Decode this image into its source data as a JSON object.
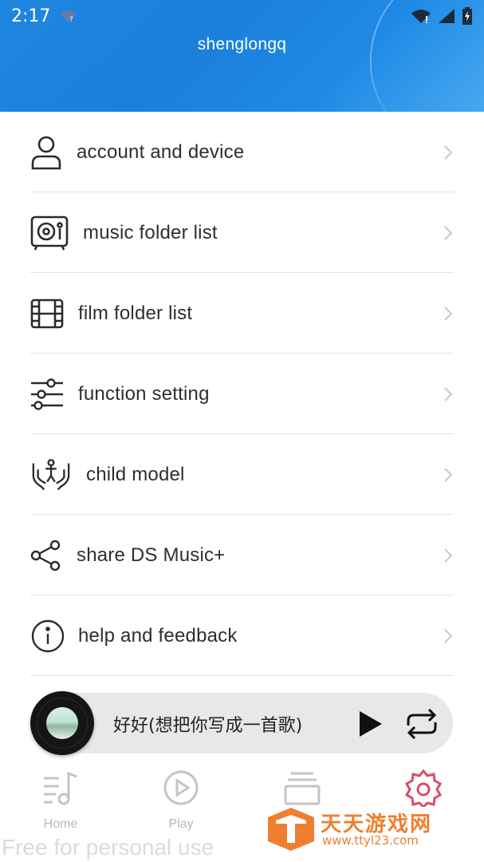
{
  "status_bar": {
    "time": "2:17",
    "icons": [
      "wifi-question-icon",
      "wifi-icon",
      "signal-icon",
      "battery-charging-icon"
    ]
  },
  "header": {
    "username": "shenglongq",
    "bg_color": "#1f86e0"
  },
  "menu": {
    "items": [
      {
        "label": "account and device",
        "icon": "person-icon"
      },
      {
        "label": "music folder list",
        "icon": "music-box-icon"
      },
      {
        "label": "film folder list",
        "icon": "film-icon"
      },
      {
        "label": "function setting",
        "icon": "sliders-icon"
      },
      {
        "label": "child model",
        "icon": "child-hands-icon"
      },
      {
        "label": "share DS Music+",
        "icon": "share-icon"
      },
      {
        "label": "help and feedback",
        "icon": "info-icon"
      }
    ]
  },
  "player": {
    "song_title": "好好(想把你写成一首歌)",
    "play_icon": "play-icon",
    "repeat_icon": "repeat-icon"
  },
  "bottom_nav": {
    "items": [
      {
        "label": "Home",
        "icon": "music-note-icon"
      },
      {
        "label": "Play",
        "icon": "play-circle-icon"
      },
      {
        "label": "",
        "icon": "stack-icon"
      },
      {
        "label": "",
        "icon": "gear-icon"
      }
    ],
    "active_color": "#e04a6a"
  },
  "watermark": {
    "text": "Free for personal use",
    "brand": "天天游戏网",
    "url": "www.ttyl23.com"
  }
}
